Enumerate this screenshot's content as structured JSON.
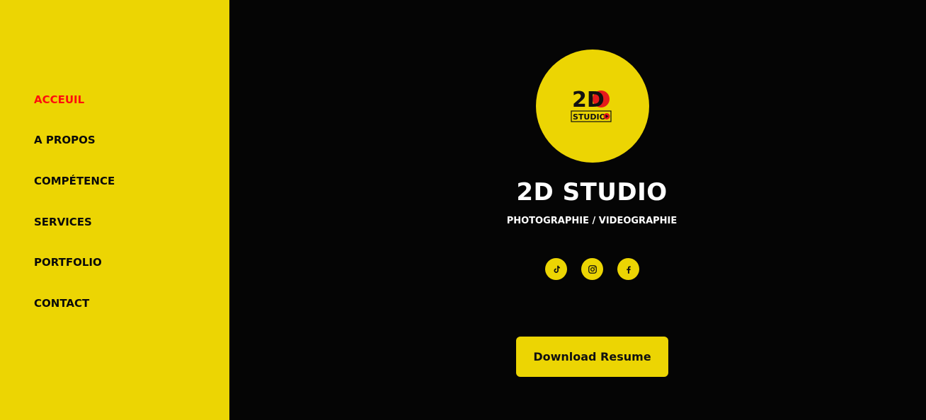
{
  "colors": {
    "accent": "#ecd503",
    "background": "#050505",
    "active_nav": "#ff0d0d",
    "text_dark": "#0a0a0a",
    "text_light": "#ffffff"
  },
  "sidebar": {
    "items": [
      {
        "label": "ACCEUIL",
        "active": true
      },
      {
        "label": "A PROPOS",
        "active": false
      },
      {
        "label": "COMPÉTENCE",
        "active": false
      },
      {
        "label": "SERVICES",
        "active": false
      },
      {
        "label": "PORTFOLIO",
        "active": false
      },
      {
        "label": "CONTACT",
        "active": false
      }
    ]
  },
  "profile": {
    "logo_mark": "2D",
    "logo_word": "STUDIO",
    "name": "2D STUDIO",
    "tagline": "PHOTOGRAPHIE / VIDEOGRAPHIE"
  },
  "social": [
    {
      "icon": "tiktok-icon"
    },
    {
      "icon": "instagram-icon"
    },
    {
      "icon": "facebook-icon"
    }
  ],
  "actions": {
    "download_label": "Download Resume"
  }
}
